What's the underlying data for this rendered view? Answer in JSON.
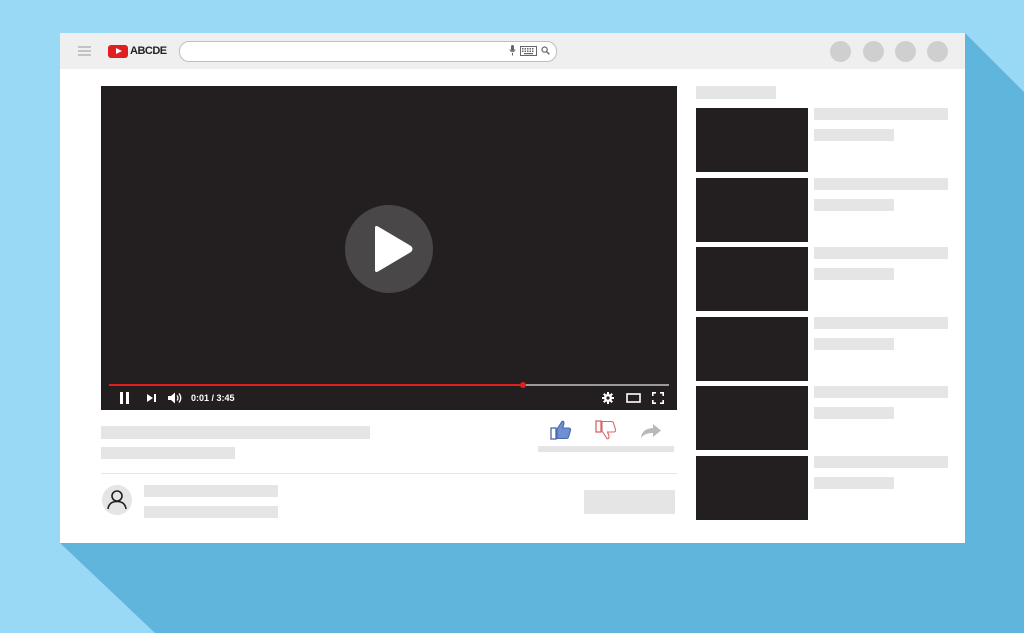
{
  "brand": {
    "logo_text": "ABCDE",
    "accent_color": "#e02020"
  },
  "search": {
    "icons": [
      "microphone-icon",
      "keyboard-icon",
      "search-icon"
    ]
  },
  "player": {
    "current_time": "0:01",
    "separator": " / ",
    "duration": "3:45",
    "progress_percent": 74,
    "controls": [
      "pause-icon",
      "next-icon",
      "volume-icon",
      "settings-icon",
      "theater-mode-icon",
      "fullscreen-icon"
    ]
  },
  "actions": [
    "like-icon",
    "dislike-icon",
    "share-icon"
  ],
  "recommendations_count_visible": 6
}
